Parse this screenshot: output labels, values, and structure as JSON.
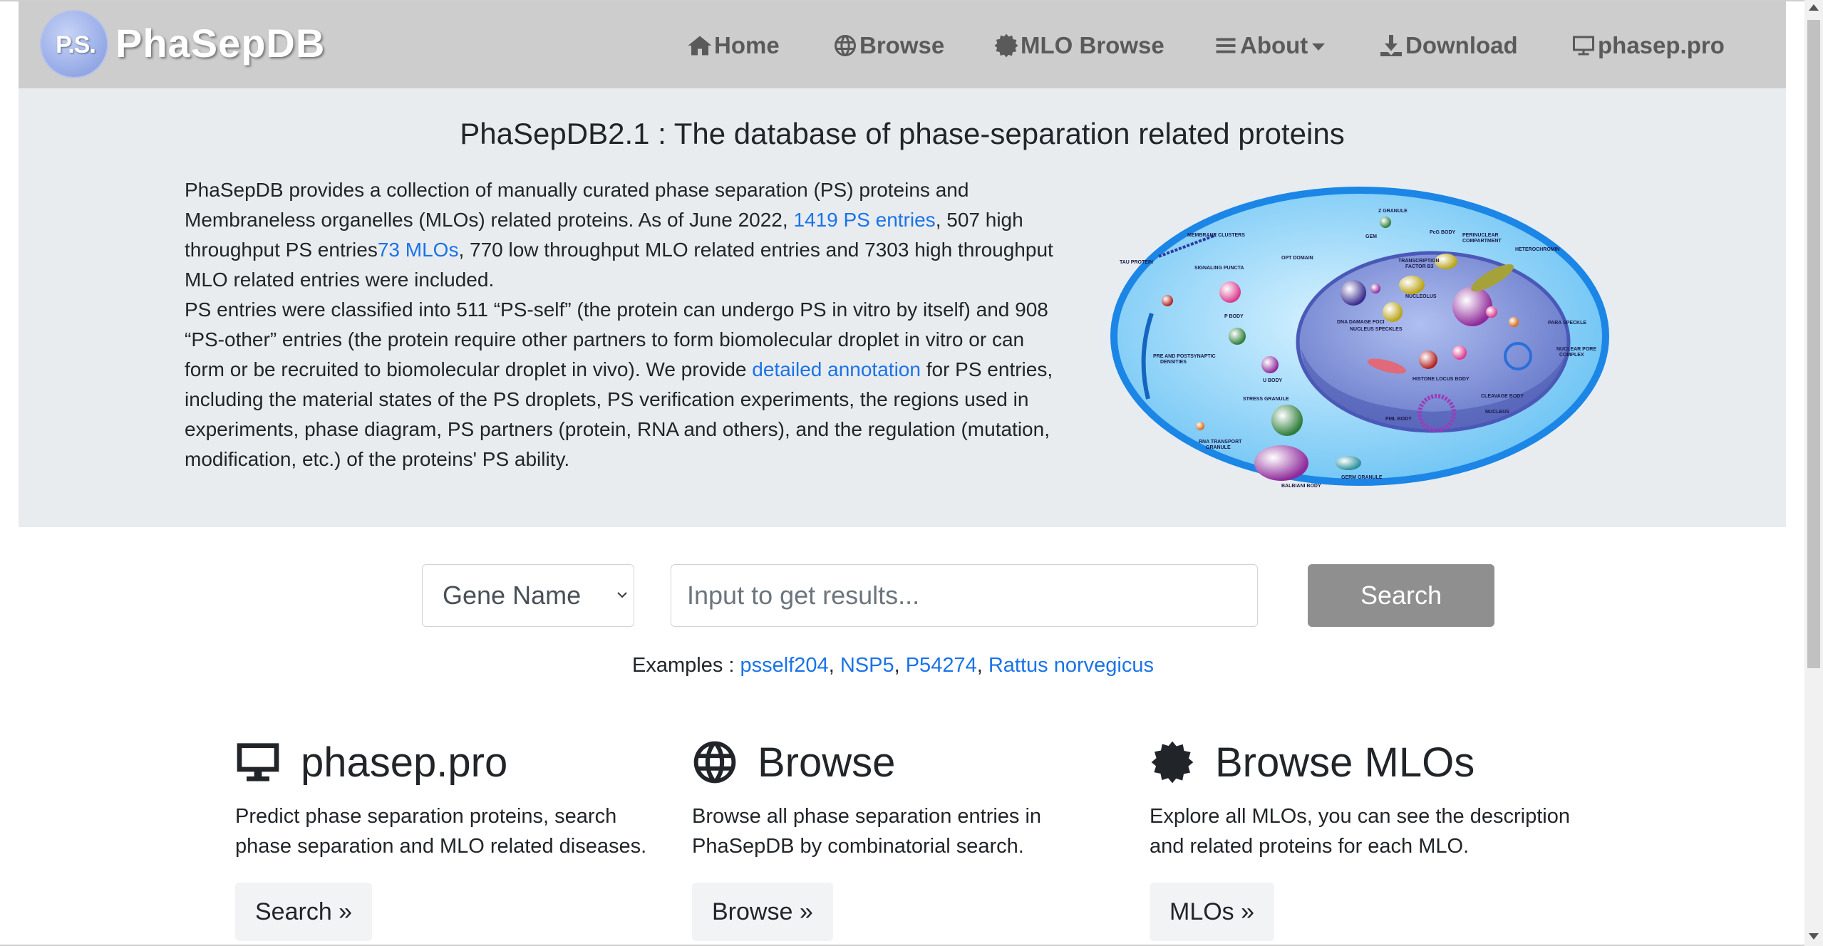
{
  "logo": {
    "badge_text": "P.S.",
    "title": "PhaSepDB"
  },
  "nav": {
    "home": "Home",
    "browse": "Browse",
    "mlo_browse": "MLO Browse",
    "about": "About",
    "download": "Download",
    "phasep": "phasep.pro"
  },
  "hero": {
    "title": "PhaSepDB2.1 : The database of phase-separation related proteins",
    "p1_a": "PhaSepDB provides a collection of manually curated phase separation (PS) proteins and Membraneless organelles (MLOs) related proteins. As of June 2022, ",
    "p1_link1": "1419 PS entries",
    "p1_b": ", 507 high throughput PS entries",
    "p1_link2": "73 MLOs",
    "p1_c": ", 770 low throughput MLO related entries and 7303 high throughput MLO related entries were included.",
    "p2_a": "PS entries were classified into 511 “PS-self” (the protein can undergo PS in vitro by itself) and 908 “PS-other” entries (the protein require other partners to form biomolecular droplet in vitro or can form or be recruited to biomolecular droplet in vivo). We provide ",
    "p2_link": "detailed annotation",
    "p2_b": " for PS entries, including the material states of the PS droplets, PS verification experiments, the regions used in experiments, phase diagram, PS partners (protein, RNA and others), and the regulation (mutation, modification, etc.) of the proteins' PS ability."
  },
  "cell_labels": {
    "z_granule": "Z GRANULE",
    "membrane_clusters": "MEMBRANE CLUSTERS",
    "gem": "GEM",
    "pgb_body": "PcG BODY",
    "perinuclear": "PERINUCLEAR",
    "compartment": "COMPARTMENT",
    "heterochromin": "HETEROCHROMIN",
    "tau_protein": "TAU PROTEIN",
    "opt_domain": "OPT DOMAIN",
    "transcription": "TRANSCRIPTION",
    "factor": "FACTOR B3",
    "signaling_puncta": "SIGNALING PUNCTA",
    "nucleolus": "NUCLEOLUS",
    "p_body": "P BODY",
    "dna_damage": "DNA DAMAGE FOCI",
    "nuclear_speckles": "NUCLEUS SPECKLES",
    "paraspeckle": "PARA SPECKLE",
    "nuclear_pore": "NUCLEAR PORE",
    "complex": "COMPLEX",
    "pre_post": "PRE AND POSTSYNAPTIC",
    "densities": "DENSITIES",
    "u_body": "U BODY",
    "histone_locus": "HISTONE LOCUS BODY",
    "cleavage_body": "CLEAVAGE BODY",
    "stress_granule": "STRESS GRANULE",
    "nucleus": "NUCLEUS",
    "pml_body": "PML BODY",
    "rna_transport": "RNA TRANSPORT",
    "granule": "GRANULE",
    "germ_granule": "GERM GRANULE",
    "balbiani_body": "BALBIANI BODY"
  },
  "search": {
    "select_value": "Gene Name",
    "placeholder": "Input to get results...",
    "button": "Search",
    "examples_label": "Examples :",
    "examples": [
      "psself204",
      "NSP5",
      "P54274",
      "Rattus norvegicus"
    ]
  },
  "features": [
    {
      "icon": "monitor-icon",
      "title": "phasep.pro",
      "desc": "Predict phase separation proteins, search phase separation and MLO related diseases.",
      "button": "Search »"
    },
    {
      "icon": "globe-icon",
      "title": "Browse",
      "desc": "Browse all phase separation entries in PhaSepDB by combinatorial search.",
      "button": "Browse »"
    },
    {
      "icon": "certificate-icon",
      "title": "Browse MLOs",
      "desc": "Explore all MLOs, you can see the description and related proteins for each MLO.",
      "button": "MLOs »"
    }
  ],
  "colors": {
    "navbar": "#cdcdcd",
    "hero": "#e9ecef",
    "link": "#1a73e8",
    "search_button": "#8f8f8f"
  }
}
